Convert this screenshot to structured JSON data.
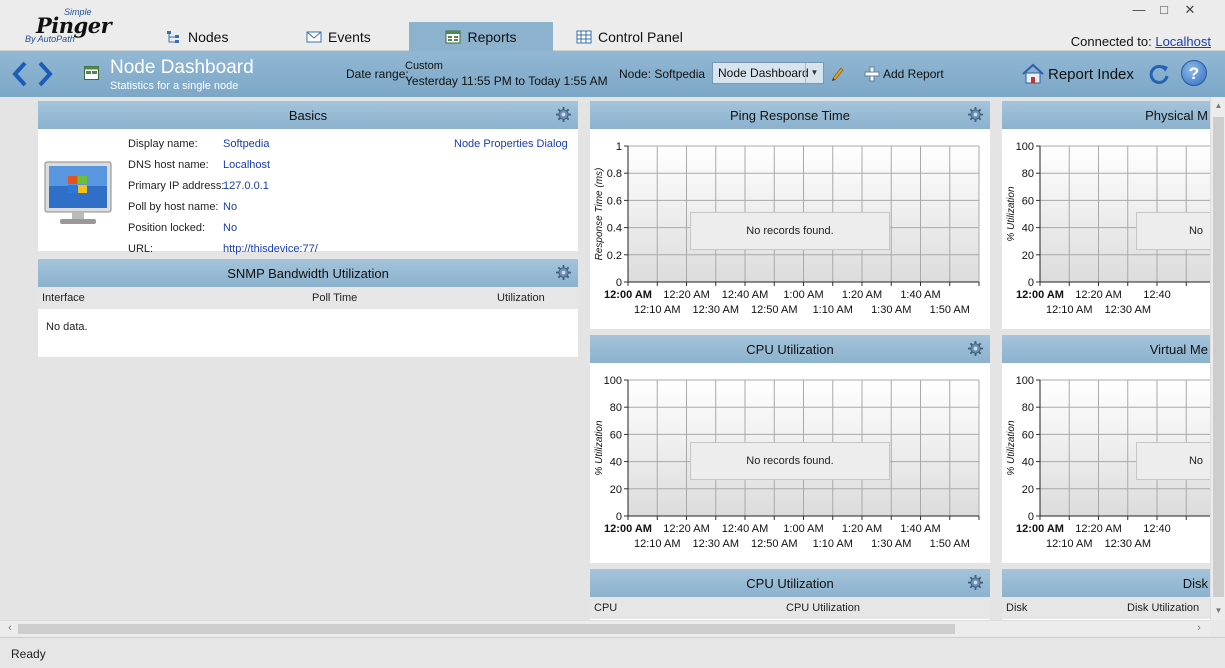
{
  "app": {
    "logo_simple": "Simple",
    "logo_name": "Pinger",
    "logo_by": "By AutoPath"
  },
  "tabs": [
    {
      "label": "Nodes",
      "active": false
    },
    {
      "label": "Events",
      "active": false
    },
    {
      "label": "Reports",
      "active": true
    },
    {
      "label": "Control Panel",
      "active": false
    }
  ],
  "connection": {
    "label": "Connected to:",
    "host": "Localhost"
  },
  "toolbar": {
    "title": "Node Dashboard",
    "subtitle": "Statistics for a single node",
    "range_label": "Date range:",
    "range_type": "Custom",
    "range_value": "Yesterday 11:55 PM to Today 1:55 AM",
    "node_label": "Node: Softpedia",
    "dashboard_select": "Node Dashboard",
    "add_report": "Add Report",
    "report_index": "Report Index",
    "help": "?"
  },
  "basics": {
    "title": "Basics",
    "link": "Node Properties Dialog",
    "fields": [
      {
        "label": "Display name:",
        "value": "Softpedia"
      },
      {
        "label": "DNS host name:",
        "value": "Localhost"
      },
      {
        "label": "Primary IP address:",
        "value": "127.0.0.1"
      },
      {
        "label": "Poll by host name:",
        "value": "No"
      },
      {
        "label": "Position locked:",
        "value": "No"
      },
      {
        "label": "URL:",
        "value": "http://thisdevice:77/"
      }
    ]
  },
  "snmp": {
    "title": "SNMP Bandwidth Utilization",
    "columns": [
      "Interface",
      "Poll Time",
      "Utilization"
    ],
    "empty": "No data."
  },
  "chart_data": [
    {
      "type": "line",
      "title": "Ping Response Time",
      "ylabel": "Response Time (ms)",
      "xlabel": "",
      "yticks": [
        "0",
        "0.2",
        "0.4",
        "0.6",
        "0.8",
        "1"
      ],
      "ylim": [
        0,
        1
      ],
      "xticks_top": [
        "12:00 AM",
        "12:20 AM",
        "12:40 AM",
        "1:00 AM",
        "1:20 AM",
        "1:40 AM"
      ],
      "xticks_bottom": [
        "12:10 AM",
        "12:30 AM",
        "12:50 AM",
        "1:10 AM",
        "1:30 AM",
        "1:50 AM"
      ],
      "series": [],
      "grid": true,
      "message": "No records found."
    },
    {
      "type": "line",
      "title": "Physical M",
      "ylabel": "% Utilization",
      "xlabel": "",
      "yticks": [
        "0",
        "20",
        "40",
        "60",
        "80",
        "100"
      ],
      "ylim": [
        0,
        100
      ],
      "xticks_top": [
        "12:00 AM",
        "12:20 AM",
        "12:40"
      ],
      "xticks_bottom": [
        "12:10 AM",
        "12:30 AM"
      ],
      "series": [],
      "grid": true,
      "message": "No"
    },
    {
      "type": "line",
      "title": "CPU Utilization",
      "ylabel": "% Utilization",
      "xlabel": "",
      "yticks": [
        "0",
        "20",
        "40",
        "60",
        "80",
        "100"
      ],
      "ylim": [
        0,
        100
      ],
      "xticks_top": [
        "12:00 AM",
        "12:20 AM",
        "12:40 AM",
        "1:00 AM",
        "1:20 AM",
        "1:40 AM"
      ],
      "xticks_bottom": [
        "12:10 AM",
        "12:30 AM",
        "12:50 AM",
        "1:10 AM",
        "1:30 AM",
        "1:50 AM"
      ],
      "series": [],
      "grid": true,
      "message": "No records found."
    },
    {
      "type": "line",
      "title": "Virtual Me",
      "ylabel": "% Utilization",
      "xlabel": "",
      "yticks": [
        "0",
        "20",
        "40",
        "60",
        "80",
        "100"
      ],
      "ylim": [
        0,
        100
      ],
      "xticks_top": [
        "12:00 AM",
        "12:20 AM",
        "12:40"
      ],
      "xticks_bottom": [
        "12:10 AM",
        "12:30 AM"
      ],
      "series": [],
      "grid": true,
      "message": "No"
    }
  ],
  "cpu_table": {
    "title": "CPU Utilization",
    "columns": [
      "CPU",
      "CPU Utilization"
    ]
  },
  "disk_table": {
    "title": "Disk",
    "columns": [
      "Disk",
      "Disk Utilization"
    ]
  },
  "status": "Ready",
  "colors": {
    "accent": "#8cb2ce",
    "link": "#1a3cb0",
    "header": "#92b8d4"
  }
}
